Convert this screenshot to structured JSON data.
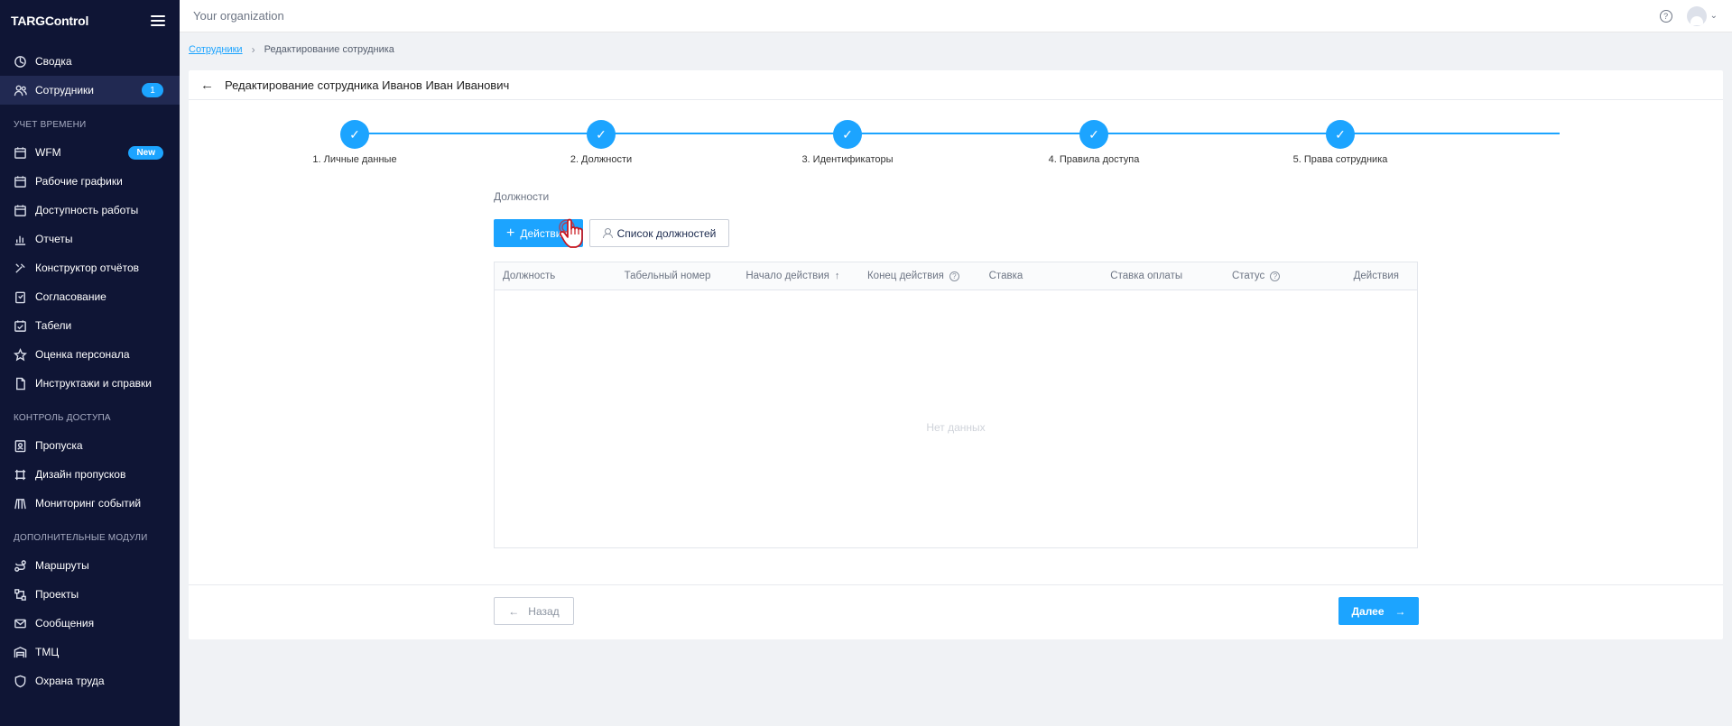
{
  "sidebar": {
    "brand": "TARGControl",
    "main_items": [
      {
        "label": "Сводка",
        "icon": "dashboard-icon"
      },
      {
        "label": "Сотрудники",
        "icon": "users-icon",
        "badge": "1"
      }
    ],
    "sections": [
      {
        "title": "УЧЕТ ВРЕМЕНИ",
        "items": [
          {
            "label": "WFM",
            "icon": "calendar-icon",
            "badge": "New"
          },
          {
            "label": "Рабочие графики",
            "icon": "calendar-icon"
          },
          {
            "label": "Доступность работы",
            "icon": "calendar-icon"
          },
          {
            "label": "Отчеты",
            "icon": "bar-chart-icon"
          },
          {
            "label": "Конструктор отчётов",
            "icon": "tools-icon"
          },
          {
            "label": "Согласование",
            "icon": "clipboard-icon"
          },
          {
            "label": "Табели",
            "icon": "calendar-check-icon"
          },
          {
            "label": "Оценка персонала",
            "icon": "star-icon"
          },
          {
            "label": "Инструктажи и справки",
            "icon": "document-icon"
          }
        ]
      },
      {
        "title": "КОНТРОЛЬ ДОСТУПА",
        "items": [
          {
            "label": "Пропуска",
            "icon": "badge-icon"
          },
          {
            "label": "Дизайн пропусков",
            "icon": "design-icon"
          },
          {
            "label": "Мониторинг событий",
            "icon": "monitor-icon"
          }
        ]
      },
      {
        "title": "ДОПОЛНИТЕЛЬНЫЕ МОДУЛИ",
        "items": [
          {
            "label": "Маршруты",
            "icon": "route-icon"
          },
          {
            "label": "Проекты",
            "icon": "project-icon"
          },
          {
            "label": "Сообщения",
            "icon": "mail-icon"
          },
          {
            "label": "ТМЦ",
            "icon": "warehouse-icon"
          },
          {
            "label": "Охрана труда",
            "icon": "shield-icon"
          }
        ]
      }
    ]
  },
  "topbar": {
    "organization": "Your organization"
  },
  "breadcrumb": {
    "parent": "Сотрудники",
    "current": "Редактирование сотрудника"
  },
  "card": {
    "title": "Редактирование сотрудника Иванов Иван Иванович",
    "steps": [
      "1. Личные данные",
      "2. Должности",
      "3. Идентификаторы",
      "4. Правила доступа",
      "5. Права сотрудника"
    ],
    "section_label": "Должности",
    "actions_button": "Действия",
    "positions_list_button": "Список должностей",
    "table": {
      "columns": [
        "Должность",
        "Табельный номер",
        "Начало действия",
        "Конец действия",
        "Ставка",
        "Ставка оплаты",
        "Статус",
        "Действия"
      ],
      "empty_text": "Нет данных"
    },
    "back_button": "Назад",
    "next_button": "Далее"
  },
  "colors": {
    "accent": "#1ca4ff",
    "sidebar_bg": "#0f1535"
  }
}
